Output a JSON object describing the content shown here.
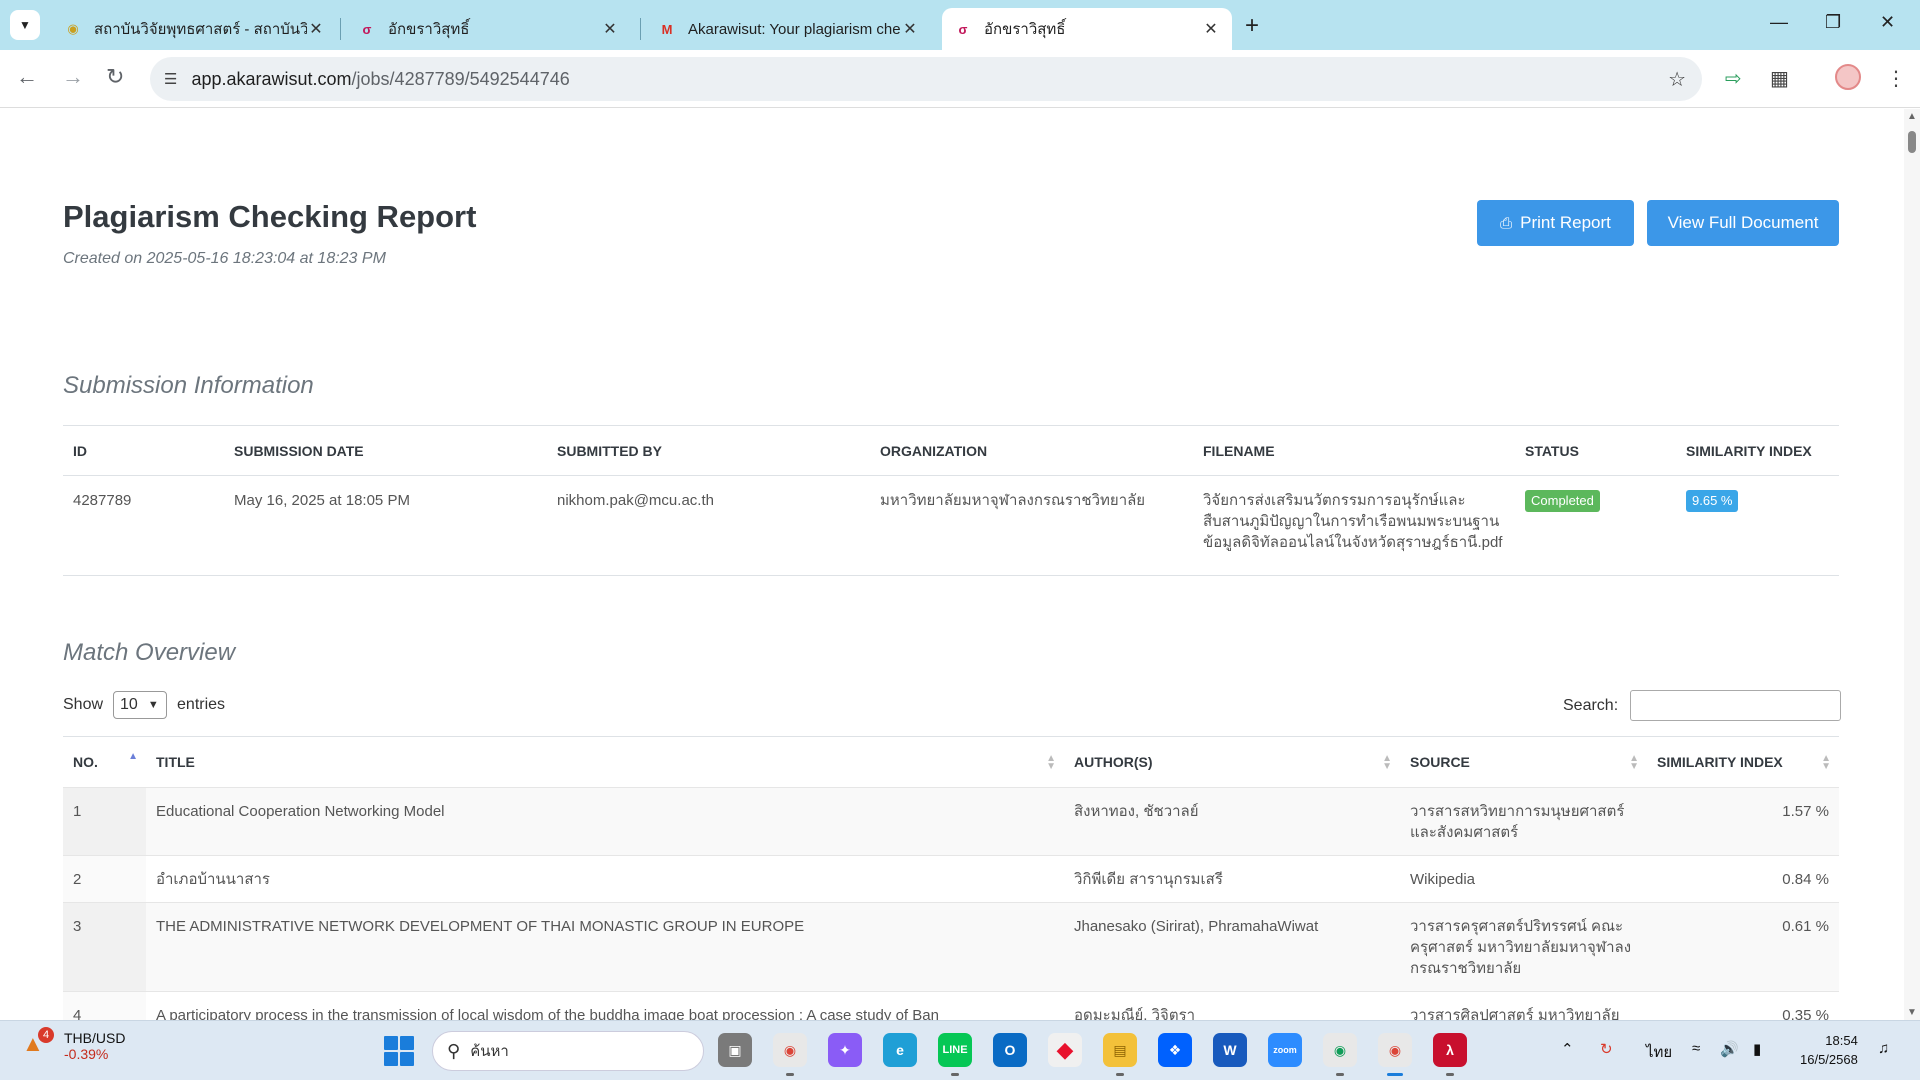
{
  "browser": {
    "tabs": [
      {
        "title": "สถาบันวิจัยพุทธศาสตร์ - สถาบันวิจัย",
        "icon": "university-seal-icon"
      },
      {
        "title": "อักขราวิสุทธิ์",
        "icon": "akarawisut-logo-icon"
      },
      {
        "title": "Akarawisut: Your plagiarism che",
        "icon": "gmail-icon"
      },
      {
        "title": "อักขราวิสุทธิ์",
        "icon": "akarawisut-logo-icon"
      }
    ],
    "url_host": "app.akarawisut.com",
    "url_path": "/jobs/4287789/5492544746"
  },
  "report": {
    "title": "Plagiarism Checking Report",
    "created": "Created on 2025-05-16 18:23:04 at 18:23 PM",
    "print_label": "Print Report",
    "print_icon": "printer-icon",
    "view_label": "View Full Document"
  },
  "submission": {
    "section_title": "Submission Information",
    "headers": [
      "ID",
      "SUBMISSION DATE",
      "SUBMITTED BY",
      "ORGANIZATION",
      "FILENAME",
      "STATUS",
      "SIMILARITY INDEX"
    ],
    "row": {
      "id": "4287789",
      "date": "May 16, 2025 at 18:05 PM",
      "submitted_by": "nikhom.pak@mcu.ac.th",
      "organization": "มหาวิทยาลัยมหาจุฬาลงกรณราชวิทยาลัย",
      "filename": "วิจัยการส่งเสริมนวัตกรรมการอนุรักษ์และสืบสานภูมิปัญญาในการทำเรือพนมพระบนฐานข้อมูลดิจิทัลออนไลน์ในจังหวัดสุราษฎร์ธานี.pdf",
      "status": "Completed",
      "status_color": "#5cb85c",
      "similarity": "9.65 %",
      "similarity_color": "#3aa6e8"
    }
  },
  "matches": {
    "section_title": "Match Overview",
    "show_label": "Show",
    "entries_value": "10",
    "entries_label": "entries",
    "search_label": "Search:",
    "headers": [
      "NO.",
      "TITLE",
      "AUTHOR(S)",
      "SOURCE",
      "SIMILARITY INDEX"
    ],
    "rows": [
      {
        "no": "1",
        "title": "Educational Cooperation Networking Model",
        "authors": "สิงหาทอง, ชัชวาลย์",
        "source": "วารสารสหวิทยาการมนุษยศาสตร์และสังคมศาสตร์",
        "similarity": "1.57 %"
      },
      {
        "no": "2",
        "title": "อำเภอบ้านนาสาร",
        "authors": "วิกิพีเดีย สารานุกรมเสรี",
        "source": "Wikipedia",
        "similarity": "0.84 %"
      },
      {
        "no": "3",
        "title": "THE ADMINISTRATIVE NETWORK DEVELOPMENT OF THAI MONASTIC GROUP IN EUROPE",
        "authors": "Jhanesako (Sirirat), PhramahaWiwat",
        "source": "วารสารครุศาสตร์ปริทรรศน์ คณะครุศาสตร์ มหาวิทยาลัยมหาจุฬาลงกรณราชวิทยาลัย",
        "similarity": "0.61 %"
      },
      {
        "no": "4",
        "title": "A participatory process in the transmission of local wisdom of the buddha image boat procession : A case study of Ban",
        "authors": "อุดมะมุณีย์, วิจิตรา",
        "source": "วารสารศิลปศาสตร์ มหาวิทยาลัย",
        "similarity": "0.35 %"
      }
    ]
  },
  "taskbar": {
    "ticker_name": "THB/USD",
    "ticker_value": "-0.39%",
    "ticker_badge": "4",
    "search_placeholder": "ค้นหา",
    "lang": "ไทย",
    "time": "18:54",
    "date": "16/5/2568"
  }
}
